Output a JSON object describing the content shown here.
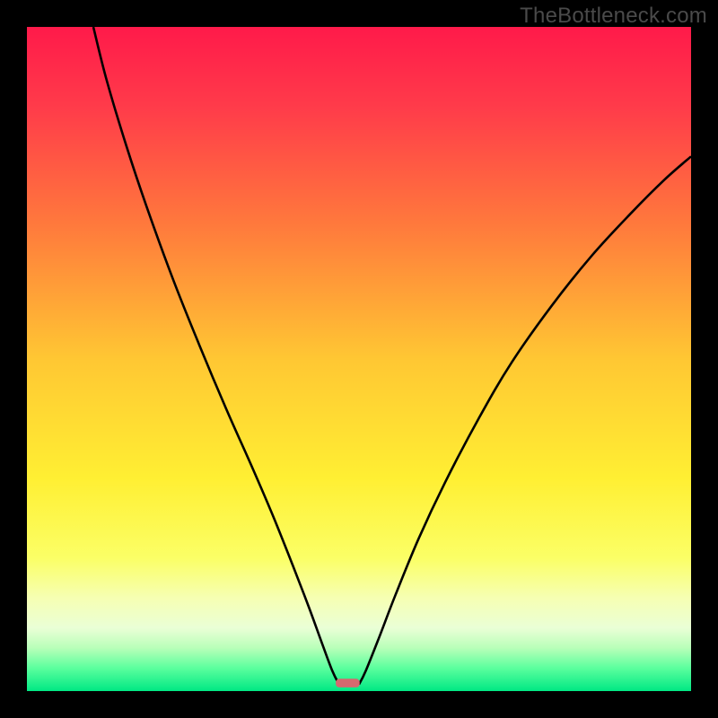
{
  "watermark": "TheBottleneck.com",
  "chart_data": {
    "type": "line",
    "title": "",
    "xlabel": "",
    "ylabel": "",
    "xlim": [
      0,
      100
    ],
    "ylim": [
      0,
      100
    ],
    "background_gradient": {
      "stops": [
        {
          "offset": 0,
          "color": "#ff1a4a"
        },
        {
          "offset": 0.12,
          "color": "#ff3b4a"
        },
        {
          "offset": 0.3,
          "color": "#ff7a3c"
        },
        {
          "offset": 0.5,
          "color": "#ffc733"
        },
        {
          "offset": 0.68,
          "color": "#ffef33"
        },
        {
          "offset": 0.8,
          "color": "#fbff66"
        },
        {
          "offset": 0.86,
          "color": "#f6ffb3"
        },
        {
          "offset": 0.905,
          "color": "#eaffd6"
        },
        {
          "offset": 0.935,
          "color": "#b9ffb9"
        },
        {
          "offset": 0.965,
          "color": "#5cff9e"
        },
        {
          "offset": 1.0,
          "color": "#00e884"
        }
      ]
    },
    "curve_left": {
      "description": "left descending branch",
      "points": [
        {
          "x": 10.0,
          "y": 100.0
        },
        {
          "x": 12.0,
          "y": 92.0
        },
        {
          "x": 15.0,
          "y": 82.0
        },
        {
          "x": 18.0,
          "y": 73.0
        },
        {
          "x": 22.0,
          "y": 62.0
        },
        {
          "x": 26.0,
          "y": 52.0
        },
        {
          "x": 30.0,
          "y": 42.5
        },
        {
          "x": 34.0,
          "y": 33.5
        },
        {
          "x": 37.0,
          "y": 26.5
        },
        {
          "x": 40.0,
          "y": 19.0
        },
        {
          "x": 42.5,
          "y": 12.5
        },
        {
          "x": 44.5,
          "y": 7.0
        },
        {
          "x": 46.0,
          "y": 3.0
        },
        {
          "x": 47.0,
          "y": 1.0
        }
      ]
    },
    "curve_right": {
      "description": "right ascending branch",
      "points": [
        {
          "x": 50.0,
          "y": 1.0
        },
        {
          "x": 51.0,
          "y": 3.0
        },
        {
          "x": 53.0,
          "y": 8.0
        },
        {
          "x": 55.5,
          "y": 14.5
        },
        {
          "x": 59.0,
          "y": 23.0
        },
        {
          "x": 63.0,
          "y": 31.5
        },
        {
          "x": 68.0,
          "y": 41.0
        },
        {
          "x": 73.0,
          "y": 49.5
        },
        {
          "x": 79.0,
          "y": 58.0
        },
        {
          "x": 85.0,
          "y": 65.5
        },
        {
          "x": 91.0,
          "y": 72.0
        },
        {
          "x": 96.0,
          "y": 77.0
        },
        {
          "x": 100.0,
          "y": 80.5
        }
      ]
    },
    "marker": {
      "description": "small rounded pink capsule at trough",
      "x": 48.3,
      "y": 1.2,
      "width": 3.6,
      "height": 1.3,
      "color": "#d5686f"
    }
  }
}
